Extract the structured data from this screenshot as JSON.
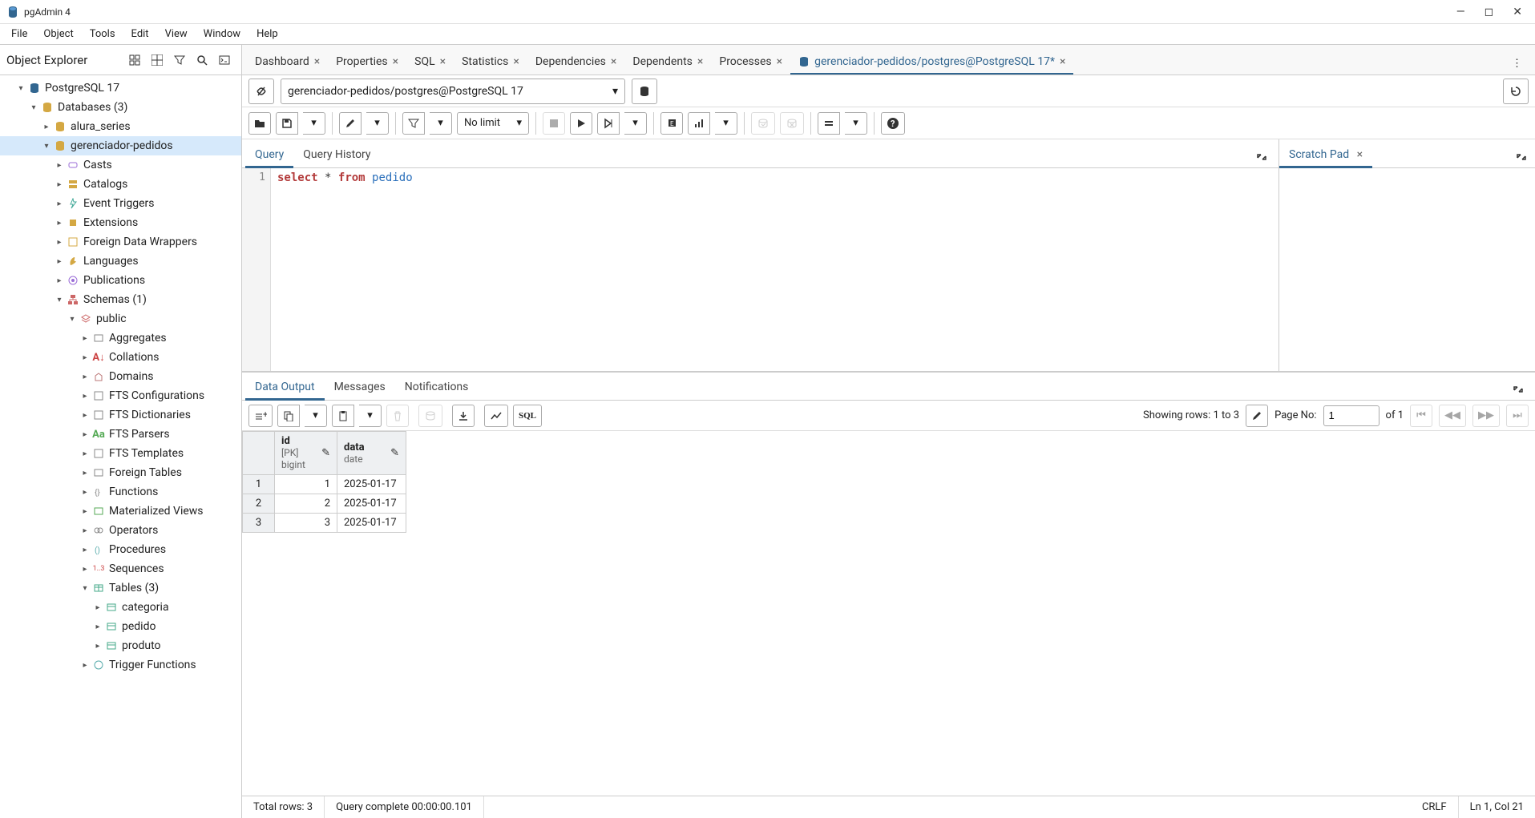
{
  "app": {
    "title": "pgAdmin 4"
  },
  "menubar": [
    "File",
    "Object",
    "Tools",
    "Edit",
    "View",
    "Window",
    "Help"
  ],
  "sidebar": {
    "title": "Object Explorer",
    "tree": {
      "server": "PostgreSQL 17",
      "databases": "Databases (3)",
      "db1": "alura_series",
      "db2": "gerenciador-pedidos",
      "casts": "Casts",
      "catalogs": "Catalogs",
      "evtrig": "Event Triggers",
      "ext": "Extensions",
      "fdw": "Foreign Data Wrappers",
      "lang": "Languages",
      "pub": "Publications",
      "schemas": "Schemas (1)",
      "public": "public",
      "agg": "Aggregates",
      "coll": "Collations",
      "dom": "Domains",
      "ftsc": "FTS Configurations",
      "ftsd": "FTS Dictionaries",
      "ftsp": "FTS Parsers",
      "ftst": "FTS Templates",
      "ftables": "Foreign Tables",
      "funcs": "Functions",
      "mviews": "Materialized Views",
      "ops": "Operators",
      "procs": "Procedures",
      "seqs": "Sequences",
      "tables": "Tables (3)",
      "t1": "categoria",
      "t2": "pedido",
      "t3": "produto",
      "trigfn": "Trigger Functions"
    }
  },
  "tabs": {
    "dashboard": "Dashboard",
    "properties": "Properties",
    "sql": "SQL",
    "statistics": "Statistics",
    "dependencies": "Dependencies",
    "dependents": "Dependents",
    "processes": "Processes",
    "query": "gerenciador-pedidos/postgres@PostgreSQL 17*"
  },
  "connection": {
    "name": "gerenciador-pedidos/postgres@PostgreSQL 17"
  },
  "toolbar": {
    "limit": "No limit"
  },
  "qtabs": {
    "query": "Query",
    "history": "Query History"
  },
  "editor": {
    "line": "1",
    "select": "select",
    "star": "*",
    "from": "from",
    "ident": "pedido"
  },
  "scratch": {
    "title": "Scratch Pad"
  },
  "output": {
    "tabs": {
      "data": "Data Output",
      "messages": "Messages",
      "notifications": "Notifications"
    },
    "showing": "Showing rows: 1 to 3",
    "page_label": "Page No:",
    "page_value": "1",
    "page_of": "of 1",
    "columns": [
      {
        "name": "id",
        "type": "[PK] bigint"
      },
      {
        "name": "data",
        "type": "date"
      }
    ],
    "rows": [
      {
        "n": "1",
        "id": "1",
        "data": "2025-01-17"
      },
      {
        "n": "2",
        "id": "2",
        "data": "2025-01-17"
      },
      {
        "n": "3",
        "id": "3",
        "data": "2025-01-17"
      }
    ]
  },
  "status": {
    "total": "Total rows: 3",
    "complete": "Query complete 00:00:00.101",
    "crlf": "CRLF",
    "cursor": "Ln 1, Col 21"
  }
}
